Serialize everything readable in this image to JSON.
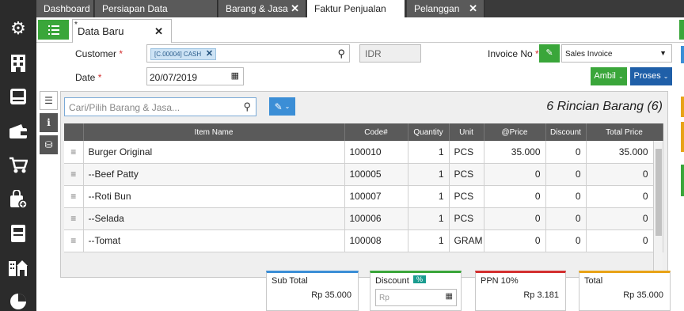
{
  "sidebar": {
    "icons": [
      "gear-icon",
      "building-icon",
      "inbox-icon",
      "wallet-icon",
      "cart-icon",
      "bag-add-icon",
      "archive-icon",
      "city-icon",
      "pie-chart-icon"
    ]
  },
  "top_tabs": [
    {
      "label": "Dashboard",
      "closable": false
    },
    {
      "label": "Persiapan Data Perusahaan",
      "closable": false
    },
    {
      "label": "Barang & Jasa",
      "closable": true
    },
    {
      "label": "Faktur Penjualan",
      "closable": true,
      "active": true
    },
    {
      "label": "Pelanggan",
      "closable": true
    }
  ],
  "sub_tab": {
    "label": "Data Baru",
    "modified_mark": "*"
  },
  "form": {
    "customer_label": "Customer",
    "customer_chip": "[C.00004] CASH",
    "currency": "IDR",
    "invoice_no_label": "Invoice No",
    "invoice_type": "Sales Invoice",
    "date_label": "Date",
    "date_value": "20/07/2019",
    "required_mark": "*"
  },
  "buttons": {
    "ambil": "Ambil",
    "proses": "Proses"
  },
  "items_panel": {
    "search_placeholder": "Cari/Pilih Barang & Jasa...",
    "count_label": "6 Rincian Barang (6)",
    "columns": [
      "Item Name",
      "Code#",
      "Quantity",
      "Unit",
      "@Price",
      "Discount",
      "Total Price"
    ],
    "rows": [
      {
        "name": "Burger Original",
        "code": "100010",
        "qty": "1",
        "unit": "PCS",
        "price": "35.000",
        "discount": "0",
        "total": "35.000"
      },
      {
        "name": "--Beef Patty",
        "code": "100005",
        "qty": "1",
        "unit": "PCS",
        "price": "0",
        "discount": "0",
        "total": "0"
      },
      {
        "name": "--Roti Bun",
        "code": "100007",
        "qty": "1",
        "unit": "PCS",
        "price": "0",
        "discount": "0",
        "total": "0"
      },
      {
        "name": "--Selada",
        "code": "100006",
        "qty": "1",
        "unit": "PCS",
        "price": "0",
        "discount": "0",
        "total": "0"
      },
      {
        "name": "--Tomat",
        "code": "100008",
        "qty": "1",
        "unit": "GRAM",
        "price": "0",
        "discount": "0",
        "total": "0"
      }
    ]
  },
  "totals": {
    "subtotal_label": "Sub Total",
    "subtotal_value": "Rp 35.000",
    "discount_label": "Discount",
    "discount_badge": "%",
    "discount_placeholder": "Rp",
    "ppn_label": "PPN 10%",
    "ppn_value": "Rp 3.181",
    "total_label": "Total",
    "total_value": "Rp 35.000"
  },
  "colors": {
    "green": "#3aa63a",
    "blue": "#3b8ed6",
    "dark_blue": "#1f5fa8",
    "orange": "#e8a317"
  }
}
